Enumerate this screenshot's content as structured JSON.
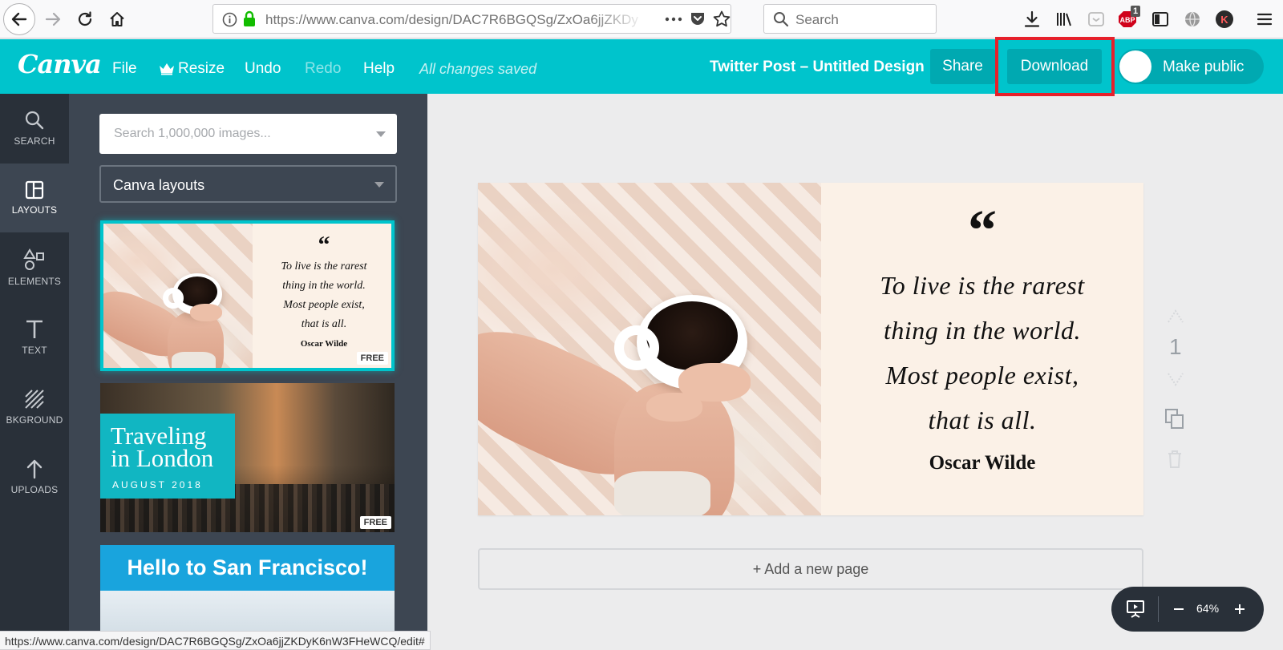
{
  "browser": {
    "url": "https://www.canva.com/design/DAC7R6BGQSg/ZxOa6jjZKDy",
    "search_placeholder": "Search",
    "adblock_count": "1",
    "profile_initial": "K",
    "status_url": "https://www.canva.com/design/DAC7R6BGQSg/ZxOa6jjZKDyK6nW3FHeWCQ/edit#"
  },
  "header": {
    "logo": "Canva",
    "menu": {
      "file": "File",
      "resize": "Resize",
      "undo": "Undo",
      "redo": "Redo",
      "help": "Help"
    },
    "save_status": "All changes saved",
    "design_title": "Twitter Post – Untitled Design",
    "share_label": "Share",
    "download_label": "Download",
    "make_public_label": "Make public"
  },
  "rail": {
    "search": "SEARCH",
    "layouts": "LAYOUTS",
    "elements": "ELEMENTS",
    "text": "TEXT",
    "background": "BKGROUND",
    "uploads": "UPLOADS"
  },
  "panel": {
    "search_placeholder": "Search 1,000,000 images...",
    "layout_select": "Canva layouts",
    "free_badge": "FREE",
    "london_title_line1": "Traveling",
    "london_title_line2": "in London",
    "london_date": "AUGUST 2018",
    "sf_title": "Hello to San Francisco!"
  },
  "design": {
    "quote_mark": "“",
    "quote_lines": [
      "To live is the rarest",
      "thing in the world.",
      "Most people exist,",
      "that is all."
    ],
    "author": "Oscar Wilde",
    "page_number": "1"
  },
  "canvas": {
    "add_page_label": "+ Add a new page"
  },
  "zoom": {
    "level": "64%"
  },
  "colors": {
    "brand_teal": "#00c4cc",
    "button_teal": "#00a9b1",
    "highlight_red": "#e6202a",
    "sidebar_dark": "#293039",
    "panel_gray": "#3d4652"
  }
}
